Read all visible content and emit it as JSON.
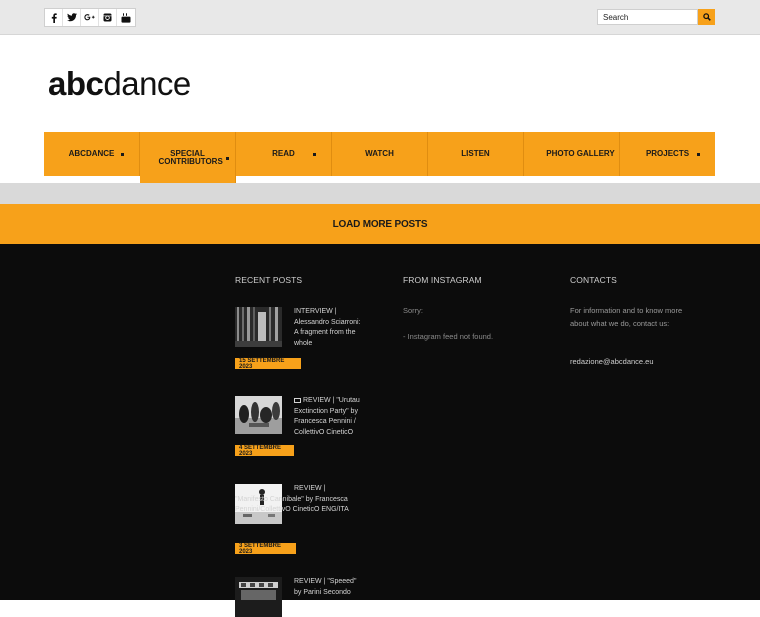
{
  "social": {
    "icons": [
      "facebook-icon",
      "twitter-icon",
      "google-plus-icon",
      "instagram-icon",
      "youtube-icon"
    ]
  },
  "search": {
    "placeholder": "Search"
  },
  "logo": {
    "part1": "abc",
    "part2": "dance"
  },
  "nav": {
    "items": [
      {
        "label": "ABCDANCE",
        "active": false,
        "has_caret": true
      },
      {
        "label": "SPECIAL CONTRIBUTORS",
        "active": true,
        "has_caret": true
      },
      {
        "label": "READ",
        "active": false,
        "has_caret": true
      },
      {
        "label": "WATCH",
        "active": false,
        "has_caret": false
      },
      {
        "label": "LISTEN",
        "active": false,
        "has_caret": false
      },
      {
        "label": "PHOTO GALLERY",
        "active": false,
        "has_caret": false
      },
      {
        "label": "PROJECTS",
        "active": false,
        "has_caret": true
      }
    ]
  },
  "load_more": {
    "label": "LOAD MORE POSTS"
  },
  "footer": {
    "recent_title": "RECENT POSTS",
    "instagram_title": "FROM INSTAGRAM",
    "contacts_title": "CONTACTS",
    "posts": [
      {
        "title": "INTERVIEW | Alessandro Sciarroni: A fragment from the whole",
        "date": "15 SETTEMBRE 2023",
        "gallery": false
      },
      {
        "title": "REVIEW | \"Urutau Exctinction Party\" by Francesca Pennini / CollettivO CineticO",
        "date": "4 SETTEMBRE 2023",
        "gallery": true
      },
      {
        "title": "REVIEW | \"Manifesto Cannibale\" by Francesca Pennini/CollettivO CineticO ENG/ITA",
        "date": "3 SETTEMBRE 2023",
        "gallery": false
      },
      {
        "title": "REVIEW | \"Speeed\" by Parini Secondo",
        "date": "",
        "gallery": false
      }
    ],
    "instagram": {
      "sorry": "Sorry:",
      "error": "- Instagram feed not found."
    },
    "contacts": {
      "intro": "For information and to know more about what we do, contact us:",
      "email": "redazione@abcdance.eu"
    }
  },
  "colors": {
    "accent": "#f7a11a",
    "footer_bg": "#0c0c0c",
    "topbar_bg": "#e8e8e8"
  }
}
